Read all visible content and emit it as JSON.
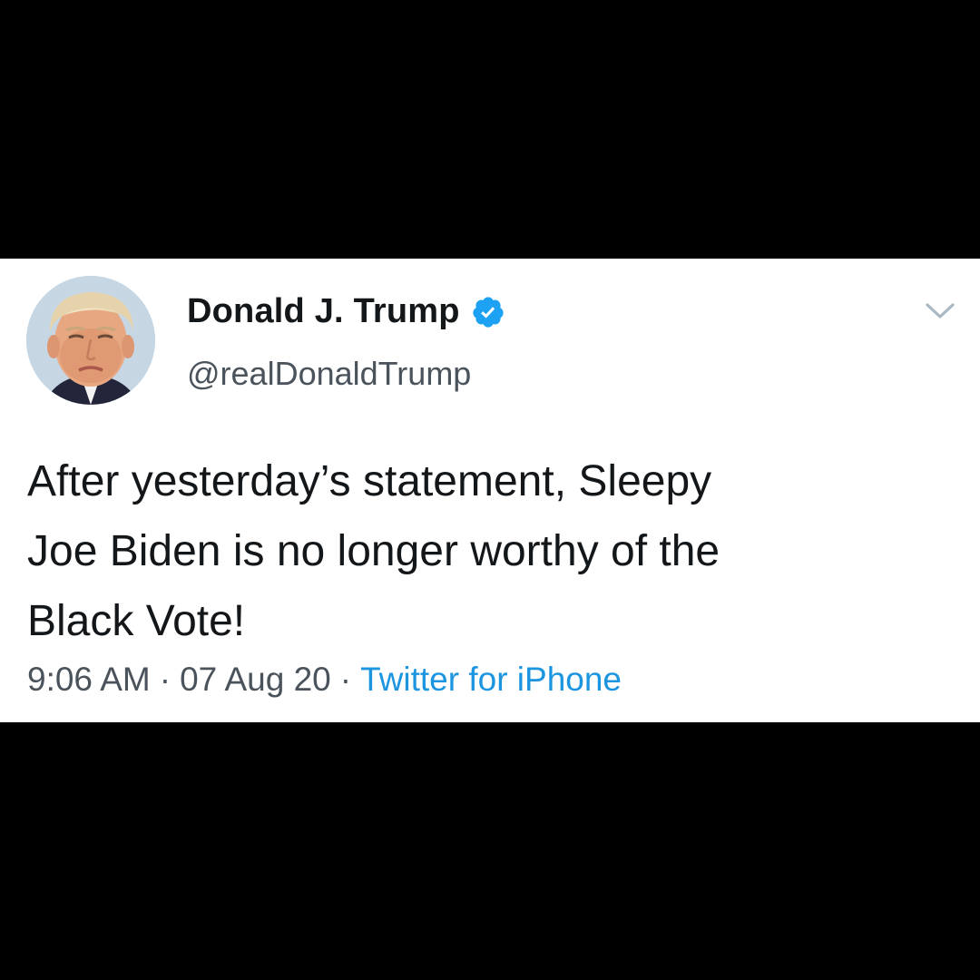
{
  "tweet": {
    "author": {
      "display_name": "Donald J. Trump",
      "handle": "@realDonaldTrump",
      "verified": true,
      "avatar_icon": "profile-photo"
    },
    "text_lines": [
      "After yesterday’s statement, Sleepy",
      "Joe Biden is no longer worthy of the",
      "Black Vote!"
    ],
    "meta": {
      "time": "9:06 AM",
      "separator": "·",
      "date": "07 Aug 20",
      "source": "Twitter for iPhone"
    },
    "menu_icon": "chevron-down-icon"
  },
  "colors": {
    "background": "#000000",
    "card": "#ffffff",
    "text": "#14171a",
    "secondary_text": "#4a535b",
    "accent": "#1b95e0",
    "verified_badge": "#1da1f2"
  }
}
